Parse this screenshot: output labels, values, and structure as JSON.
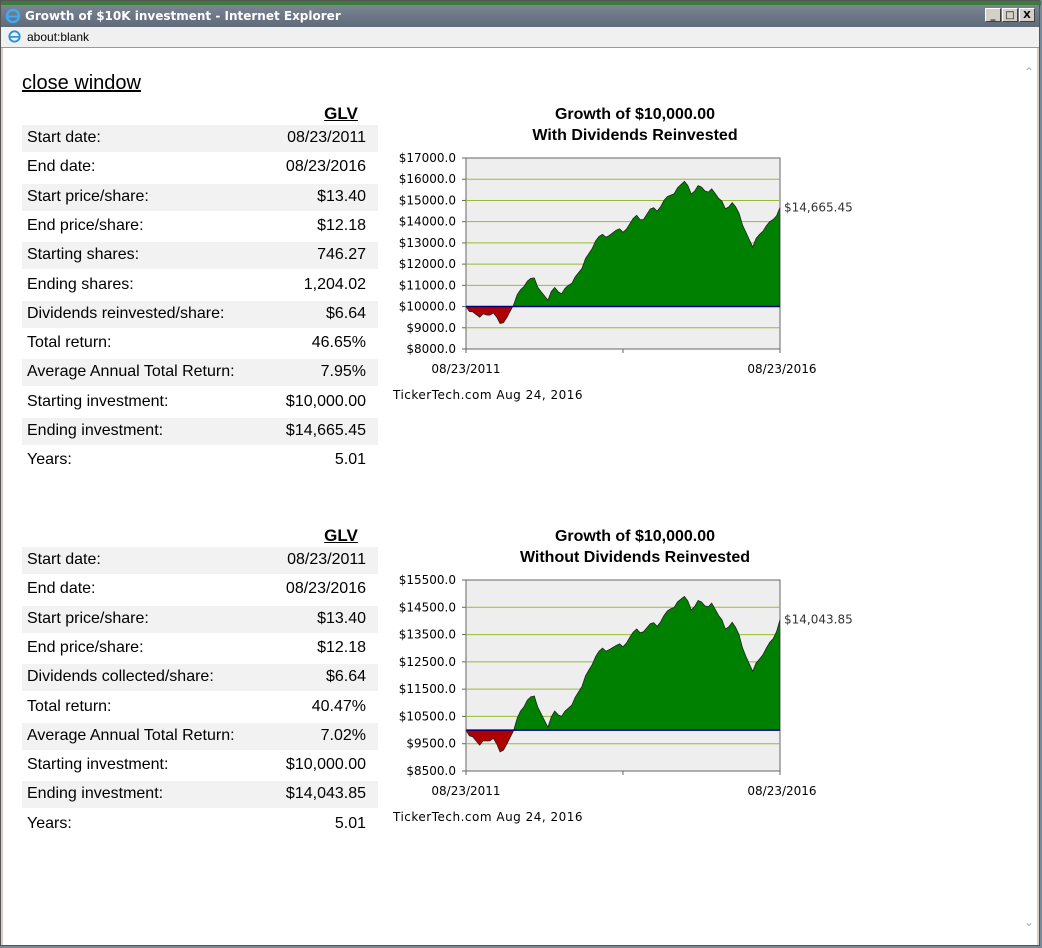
{
  "window": {
    "title": "Growth of $10K investment - Internet Explorer",
    "address": "about:blank",
    "min_label": "_",
    "max_label": "□",
    "close_label": "X"
  },
  "page": {
    "close_link": "close window"
  },
  "tables": [
    {
      "ticker": "GLV",
      "rows": [
        {
          "label": "Start date:",
          "value": "08/23/2011"
        },
        {
          "label": "End date:",
          "value": "08/23/2016"
        },
        {
          "label": "Start price/share:",
          "value": "$13.40"
        },
        {
          "label": "End price/share:",
          "value": "$12.18"
        },
        {
          "label": "Starting shares:",
          "value": "746.27"
        },
        {
          "label": "Ending shares:",
          "value": "1,204.02"
        },
        {
          "label": "Dividends reinvested/share:",
          "value": "$6.64"
        },
        {
          "label": "Total return:",
          "value": "46.65%"
        },
        {
          "label": "Average Annual Total Return:",
          "value": "7.95%"
        },
        {
          "label": "Starting investment:",
          "value": "$10,000.00"
        },
        {
          "label": "Ending investment:",
          "value": "$14,665.45"
        },
        {
          "label": "Years:",
          "value": "5.01"
        }
      ]
    },
    {
      "ticker": "GLV",
      "rows": [
        {
          "label": "Start date:",
          "value": "08/23/2011"
        },
        {
          "label": "End date:",
          "value": "08/23/2016"
        },
        {
          "label": "Start price/share:",
          "value": "$13.40"
        },
        {
          "label": "End price/share:",
          "value": "$12.18"
        },
        {
          "label": "Dividends collected/share:",
          "value": "$6.64"
        },
        {
          "label": "Total return:",
          "value": "40.47%"
        },
        {
          "label": "Average Annual Total Return:",
          "value": "7.02%"
        },
        {
          "label": "Starting investment:",
          "value": "$10,000.00"
        },
        {
          "label": "Ending investment:",
          "value": "$14,043.85"
        },
        {
          "label": "Years:",
          "value": "5.01"
        }
      ]
    }
  ],
  "colors": {
    "gain": "#008000",
    "loss": "#b00000",
    "baseline": "#000080",
    "grid": "#99bb33",
    "plot_bg": "#eeeeee"
  },
  "chart_data": [
    {
      "type": "area",
      "title": "Growth of $10,000.00",
      "subtitle": "With Dividends Reinvested",
      "yticks": [
        "$17000.0",
        "$16000.0",
        "$15000.0",
        "$14000.0",
        "$13000.0",
        "$12000.0",
        "$11000.0",
        "$10000.0",
        "$9000.0",
        "$8000.0"
      ],
      "ylim": [
        8000,
        17000
      ],
      "baseline": 10000,
      "x": [
        "08/23/2011",
        "08/23/2016"
      ],
      "xticks": [
        "08/23/2011",
        "08/23/2016"
      ],
      "end_label": "$14,665.45",
      "source": "TickerTech.com  Aug 24, 2016",
      "values": [
        10000,
        9750,
        9500,
        9600,
        9700,
        9200,
        9500,
        10100,
        10800,
        11200,
        11350,
        10700,
        10300,
        10900,
        10600,
        11000,
        11400,
        11800,
        12500,
        13100,
        13400,
        13350,
        13600,
        13500,
        13900,
        14300,
        14100,
        14600,
        14500,
        15000,
        15250,
        15600,
        15900,
        15300,
        15700,
        15450,
        15550,
        15100,
        14600,
        14900,
        14400,
        13500,
        12800,
        13400,
        13800,
        14100,
        14665.45
      ],
      "grid": true
    },
    {
      "type": "area",
      "title": "Growth of $10,000.00",
      "subtitle": "Without Dividends Reinvested",
      "yticks": [
        "$15500.0",
        "$14500.0",
        "$13500.0",
        "$12500.0",
        "$11500.0",
        "$10500.0",
        "$9500.0",
        "$8500.0"
      ],
      "ylim": [
        8500,
        15500
      ],
      "baseline": 10000,
      "x": [
        "08/23/2011",
        "08/23/2016"
      ],
      "xticks": [
        "08/23/2011",
        "08/23/2016"
      ],
      "end_label": "$14,043.85",
      "source": "TickerTech.com  Aug 24, 2016",
      "values": [
        10000,
        9750,
        9450,
        9600,
        9700,
        9200,
        9500,
        10000,
        10700,
        11100,
        11250,
        10600,
        10100,
        10700,
        10500,
        10800,
        11200,
        11600,
        12200,
        12700,
        13000,
        12950,
        13100,
        13050,
        13400,
        13700,
        13600,
        13900,
        13800,
        14200,
        14450,
        14700,
        14900,
        14400,
        14750,
        14550,
        14650,
        14200,
        13700,
        13950,
        13500,
        12700,
        12150,
        12600,
        13000,
        13350,
        14043.85
      ],
      "grid": true
    }
  ]
}
